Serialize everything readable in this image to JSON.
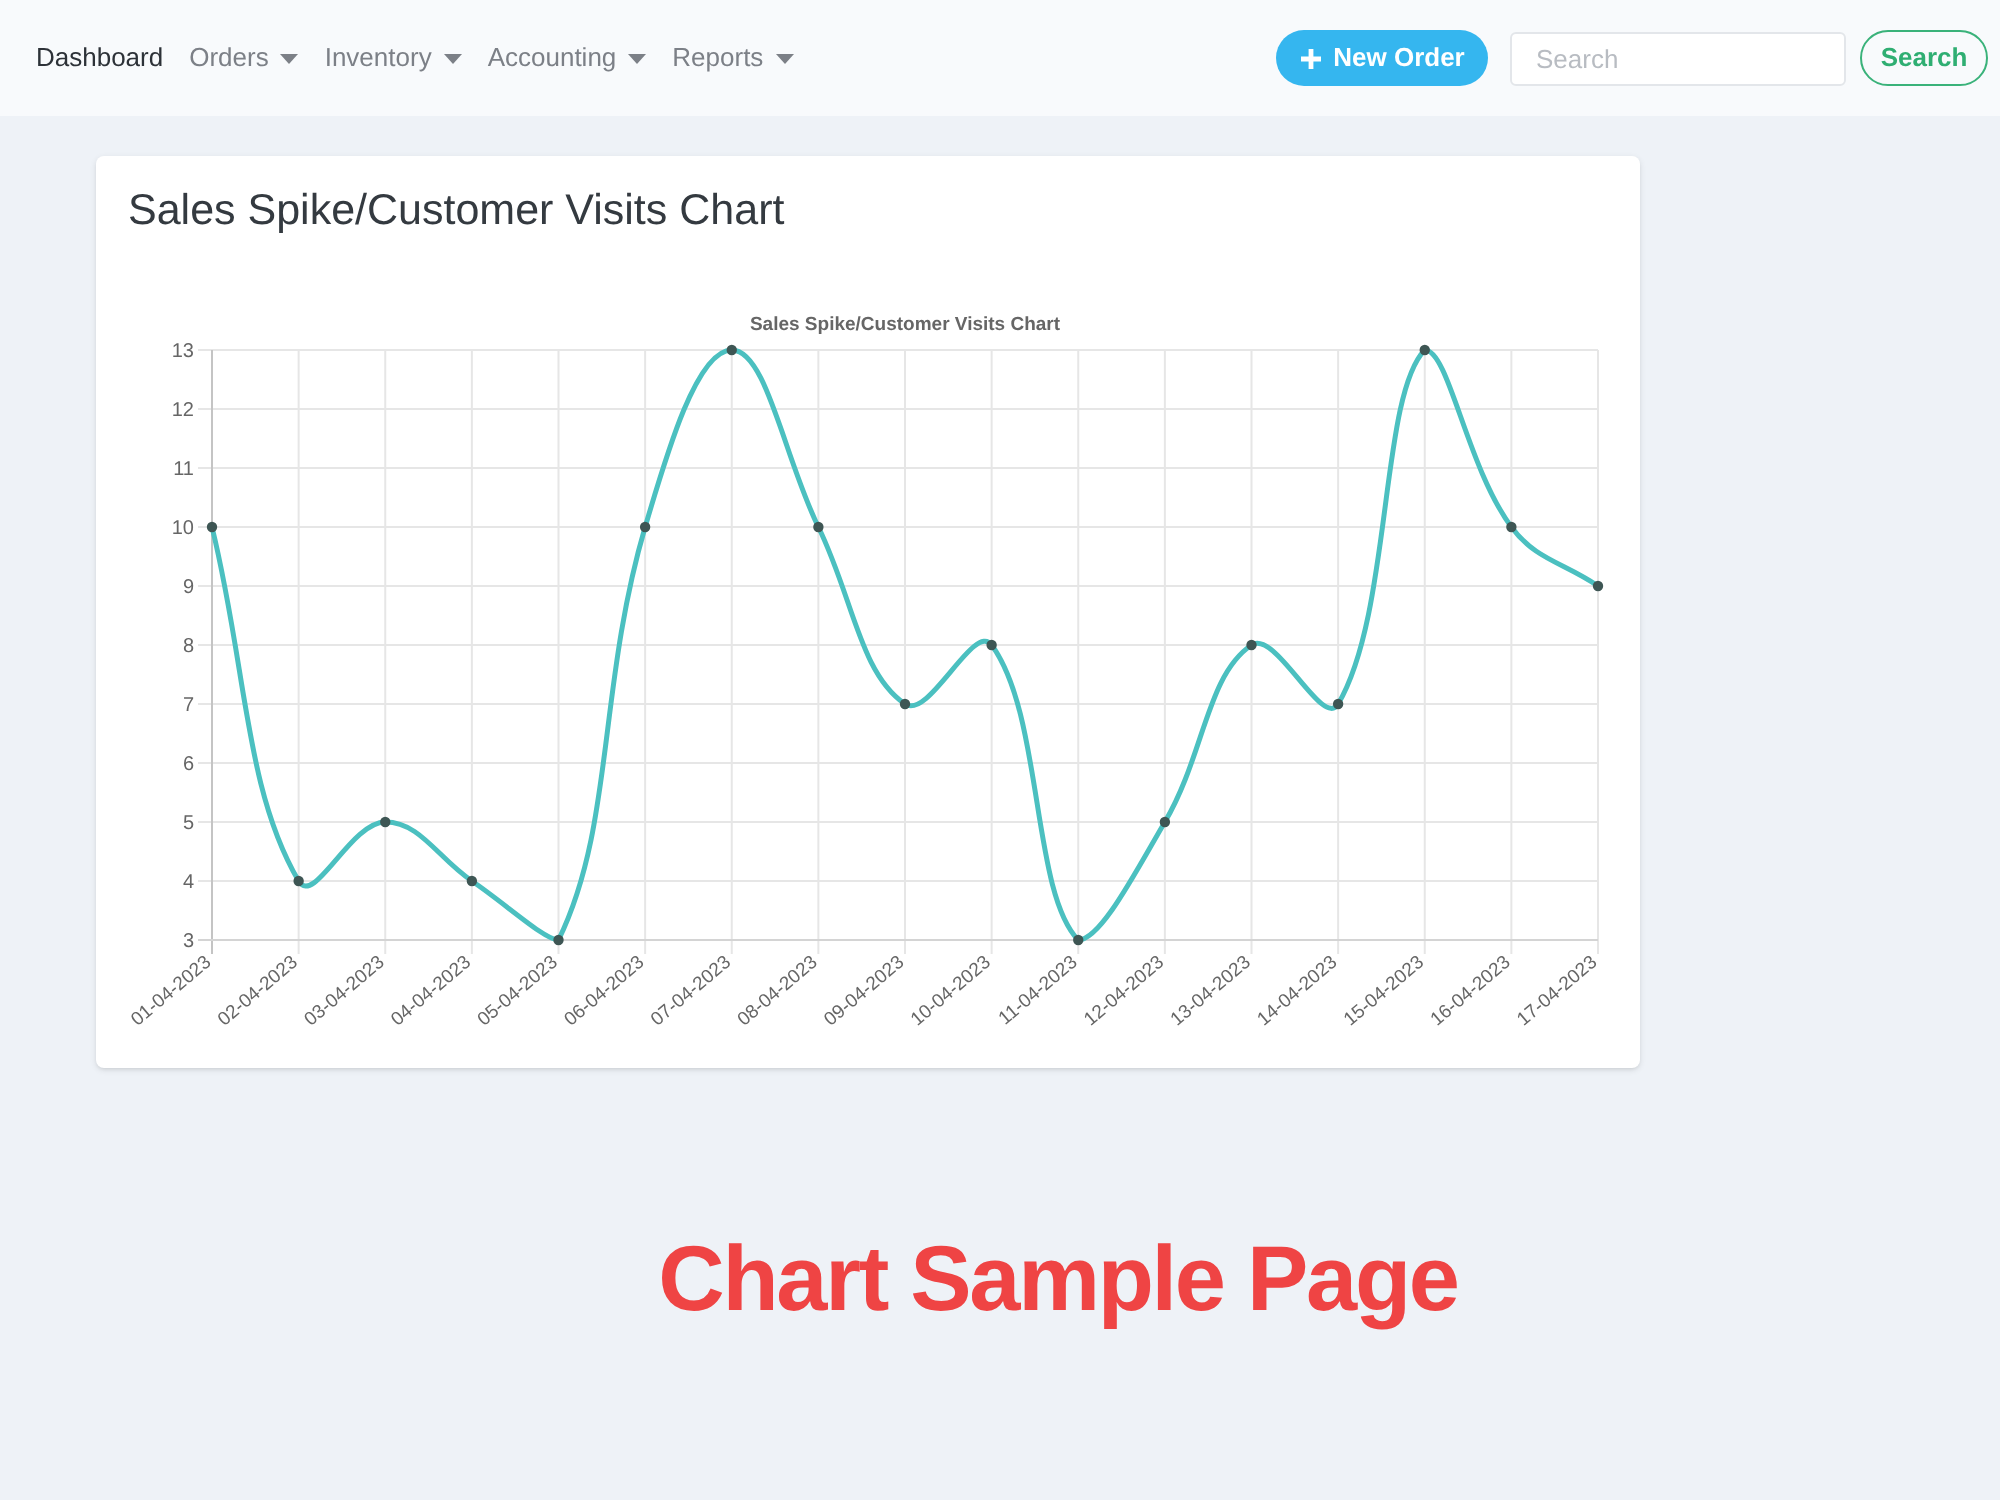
{
  "navbar": {
    "items": [
      {
        "label": "Dashboard",
        "selected": true,
        "dropdown": false
      },
      {
        "label": "Orders",
        "selected": false,
        "dropdown": true
      },
      {
        "label": "Inventory",
        "selected": false,
        "dropdown": true
      },
      {
        "label": "Accounting",
        "selected": false,
        "dropdown": true
      },
      {
        "label": "Reports",
        "selected": false,
        "dropdown": true
      }
    ],
    "new_order_button": {
      "label": "New Order"
    },
    "search": {
      "placeholder": "Search"
    },
    "search_button": {
      "label": "Search"
    }
  },
  "card": {
    "title": "Sales Spike/Customer Visits Chart",
    "chart_data": {
      "type": "line",
      "title": "Sales Spike/Customer Visits Chart",
      "categories": [
        "01-04-2023",
        "02-04-2023",
        "03-04-2023",
        "04-04-2023",
        "05-04-2023",
        "06-04-2023",
        "07-04-2023",
        "08-04-2023",
        "09-04-2023",
        "10-04-2023",
        "11-04-2023",
        "12-04-2023",
        "13-04-2023",
        "14-04-2023",
        "15-04-2023",
        "16-04-2023",
        "17-04-2023"
      ],
      "series": [
        {
          "color": "#4bc0c0",
          "marker": true,
          "values": [
            10,
            4,
            5,
            4,
            3,
            10,
            13,
            10,
            7,
            8,
            3,
            5,
            8,
            7,
            13,
            10,
            9
          ]
        }
      ],
      "ylim": [
        3,
        13
      ],
      "yticks": [
        3,
        4,
        5,
        6,
        7,
        8,
        9,
        10,
        11,
        12,
        13
      ],
      "grid": true
    }
  },
  "caption": "Chart Sample Page"
}
